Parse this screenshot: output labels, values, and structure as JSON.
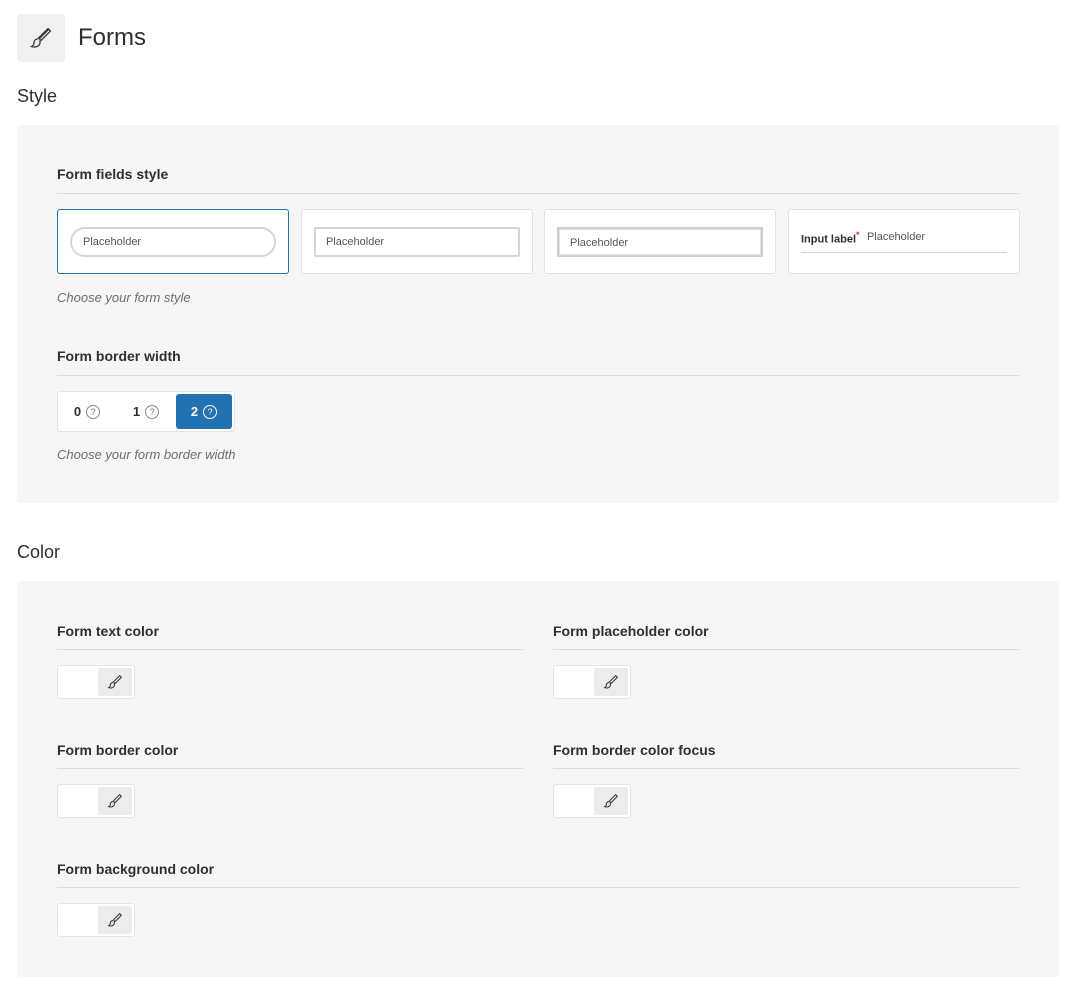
{
  "header": {
    "title": "Forms",
    "icon": "brush-icon"
  },
  "style_section": {
    "title": "Style",
    "fields_style": {
      "label": "Form fields style",
      "options": [
        {
          "id": "rounded",
          "placeholder": "Placeholder",
          "selected": true
        },
        {
          "id": "square",
          "placeholder": "Placeholder",
          "selected": false
        },
        {
          "id": "thick-border",
          "placeholder": "Placeholder",
          "selected": false
        },
        {
          "id": "underline-label",
          "label": "Input label",
          "required_mark": "*",
          "placeholder": "Placeholder",
          "selected": false
        }
      ],
      "help": "Choose your form style"
    },
    "border_width": {
      "label": "Form border width",
      "options": [
        {
          "value": "0",
          "help_icon": "?"
        },
        {
          "value": "1",
          "help_icon": "?"
        },
        {
          "value": "2",
          "help_icon": "?"
        }
      ],
      "selected": "2",
      "help": "Choose your form border width"
    }
  },
  "color_section": {
    "title": "Color",
    "fields": [
      {
        "label": "Form text color",
        "value": "#ffffff"
      },
      {
        "label": "Form placeholder color",
        "value": "#ffffff"
      },
      {
        "label": "Form border color",
        "value": "#ffffff"
      },
      {
        "label": "Form border color focus",
        "value": "#ffffff"
      },
      {
        "label": "Form background color",
        "value": "#ffffff"
      }
    ]
  },
  "colors": {
    "accent": "#2271b1",
    "panel": "#f6f6f6",
    "required": "#d63638"
  }
}
